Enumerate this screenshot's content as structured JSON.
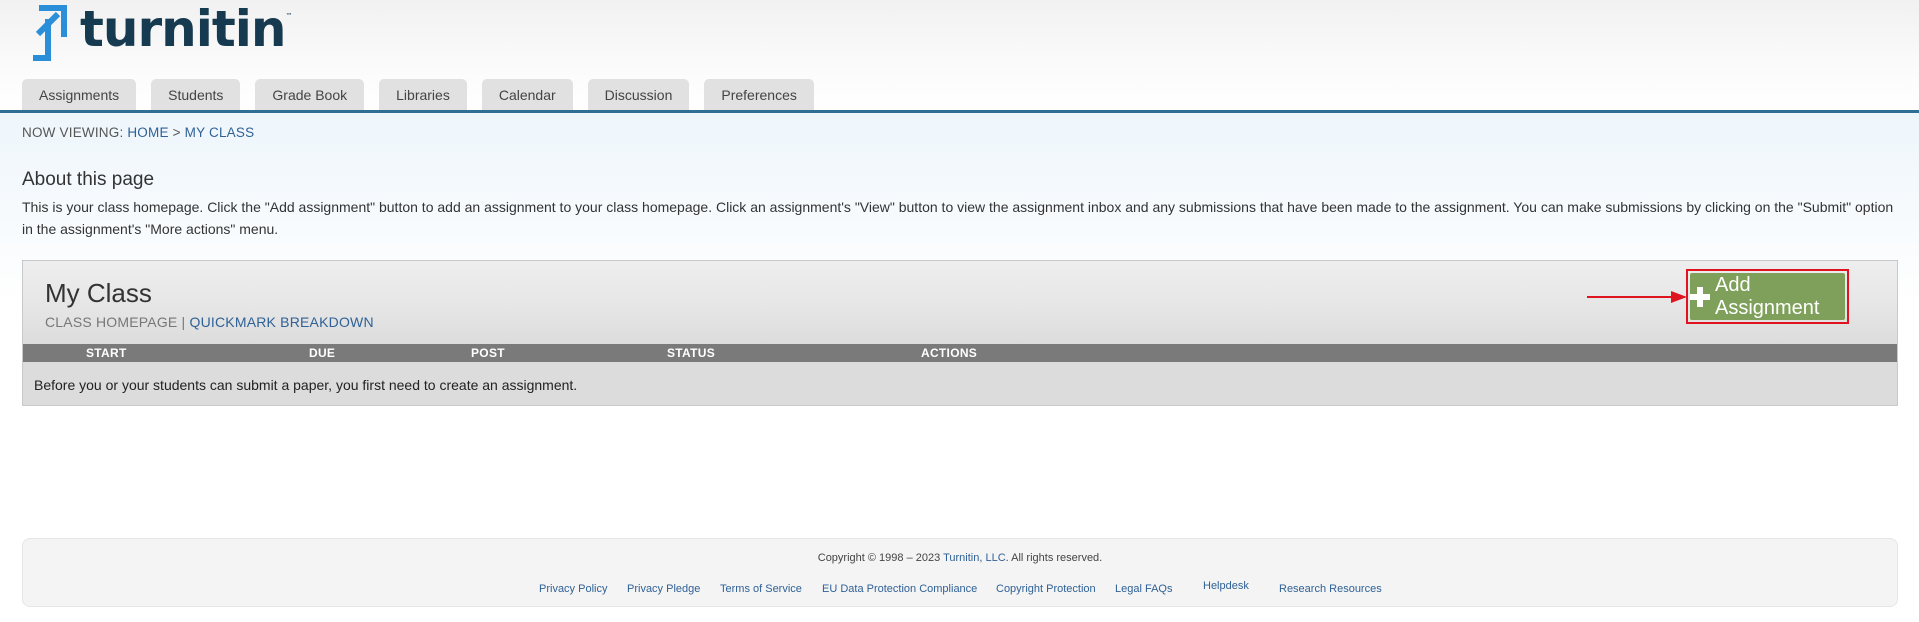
{
  "brand": {
    "name": "turnitin",
    "tm": "™",
    "color": "#163a4f",
    "accent": "#2a8fd8"
  },
  "tabs": [
    {
      "label": "Assignments"
    },
    {
      "label": "Students"
    },
    {
      "label": "Grade Book"
    },
    {
      "label": "Libraries"
    },
    {
      "label": "Calendar"
    },
    {
      "label": "Discussion"
    },
    {
      "label": "Preferences"
    }
  ],
  "breadcrumb": {
    "prefix": "NOW VIEWING: ",
    "home": "HOME",
    "separator": " > ",
    "current": "MY CLASS"
  },
  "about": {
    "title": "About this page",
    "text": "This is your class homepage. Click the \"Add assignment\" button to add an assignment to your class homepage. Click an assignment's \"View\" button to view the assignment inbox and any submissions that have been made to the assignment. You can make submissions by clicking on the \"Submit\" option in the assignment's \"More actions\" menu."
  },
  "class_panel": {
    "title": "My Class",
    "homepage_label": "CLASS HOMEPAGE",
    "separator": " | ",
    "quickmark_link": "QUICKMARK BREAKDOWN",
    "add_button": "Add Assignment",
    "add_button_color": "#7ea05a",
    "highlight_color": "#e0141e",
    "columns": [
      "START",
      "DUE",
      "POST",
      "STATUS",
      "ACTIONS"
    ],
    "empty_message": "Before you or your students can submit a paper, you first need to create an assignment."
  },
  "footer": {
    "copyright_prefix": "Copyright © 1998 – 2023 ",
    "company": "Turnitin, LLC",
    "copyright_suffix": ". All rights reserved.",
    "links": [
      "Privacy Policy",
      "Privacy Pledge",
      "Terms of Service",
      "EU Data Protection Compliance",
      "Copyright Protection",
      "Legal FAQs",
      "Helpdesk",
      "Research Resources"
    ]
  },
  "icons": {
    "logo": "turnitin-logo-icon",
    "add": "plus-icon",
    "annotation": "red-arrow-icon"
  }
}
